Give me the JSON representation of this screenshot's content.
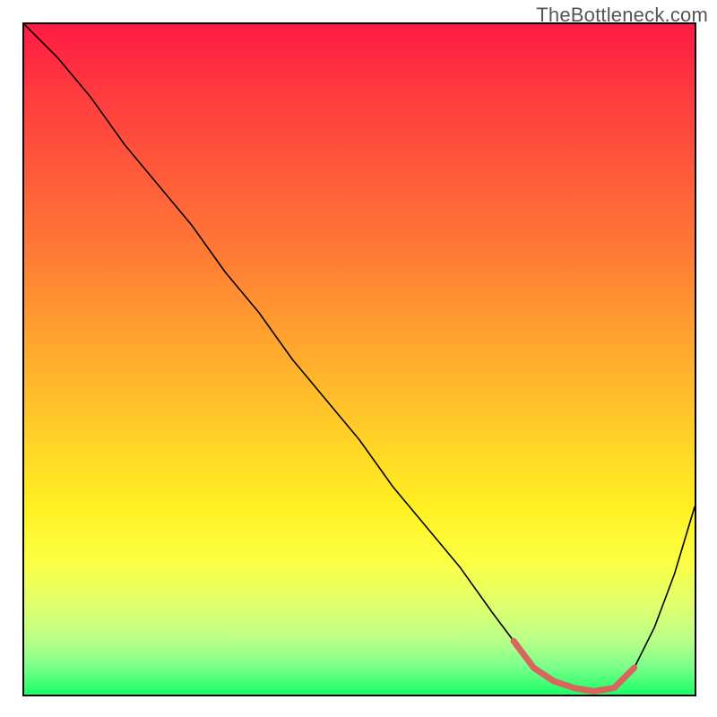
{
  "watermark": "TheBottleneck.com",
  "chart_data": {
    "type": "line",
    "title": "",
    "xlabel": "",
    "ylabel": "",
    "xlim": [
      0,
      100
    ],
    "ylim": [
      0,
      100
    ],
    "background_gradient": {
      "top_color": "#ff1a44",
      "mid_color": "#ffd826",
      "bottom_color": "#1aff66"
    },
    "series": [
      {
        "name": "bottleneck_curve",
        "color": "#000000",
        "stroke_width": 1.5,
        "x": [
          0,
          5,
          10,
          15,
          20,
          25,
          30,
          35,
          40,
          45,
          50,
          55,
          60,
          65,
          70,
          73,
          76,
          79,
          82,
          85,
          88,
          91,
          94,
          97,
          100
        ],
        "y": [
          100,
          95,
          89,
          82,
          76,
          70,
          63,
          57,
          50,
          44,
          38,
          31,
          25,
          19,
          12,
          8,
          4,
          2,
          1,
          0.5,
          1,
          4,
          10,
          18,
          28
        ]
      },
      {
        "name": "highlight_band",
        "color": "#d9655f",
        "stroke_width": 6,
        "x": [
          73,
          76,
          79,
          82,
          85,
          88,
          91
        ],
        "y": [
          8,
          4,
          2,
          1,
          0.5,
          1,
          4
        ]
      }
    ]
  }
}
